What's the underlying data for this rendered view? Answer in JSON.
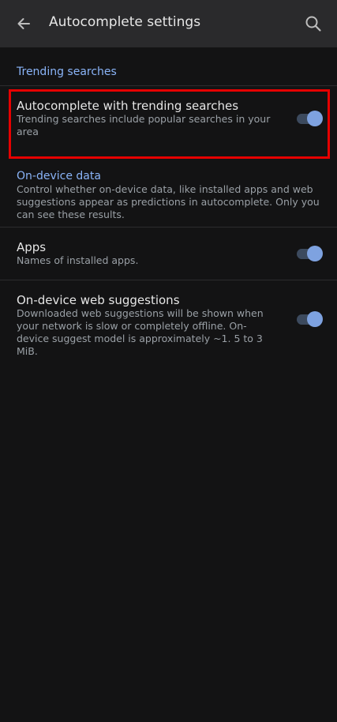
{
  "header": {
    "title": "Autocomplete settings",
    "back_icon": "arrow-left",
    "search_icon": "search"
  },
  "sections": {
    "trending": {
      "header": "Trending searches",
      "item": {
        "title": "Autocomplete with trending searches",
        "description": "Trending searches include popular searches in your area",
        "enabled": true
      }
    },
    "on_device": {
      "header": "On-device data",
      "description": "Control whether on-device data,  like installed apps and web suggestions appear as predictions in autocomplete.  Only you can see these results.",
      "apps": {
        "title": "Apps",
        "description": "Names of installed apps.",
        "enabled": true
      },
      "web": {
        "title": "On-device web suggestions",
        "description": "Downloaded web suggestions will be shown when your network is slow or completely offline.  On-device suggest model is approximately ~1. 5 to 3 MiB.",
        "enabled": true
      }
    }
  },
  "colors": {
    "accent": "#8ab4f8",
    "highlight": "#e60000",
    "background": "#131314"
  }
}
